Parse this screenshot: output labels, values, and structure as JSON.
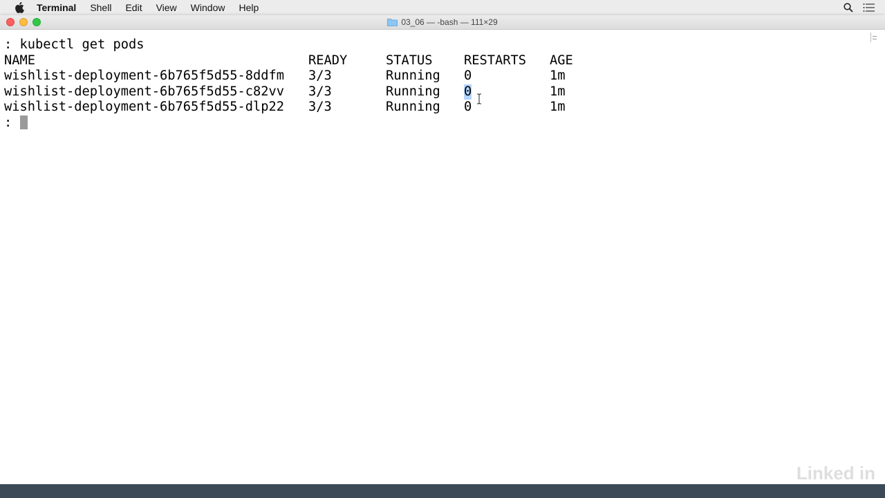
{
  "menubar": {
    "app_name": "Terminal",
    "items": [
      "Shell",
      "Edit",
      "View",
      "Window",
      "Help"
    ]
  },
  "window": {
    "title": "03_06 — -bash — 111×29"
  },
  "terminal": {
    "command_line": ": kubectl get pods",
    "headers": [
      "NAME",
      "READY",
      "STATUS",
      "RESTARTS",
      "AGE"
    ],
    "rows": [
      [
        "wishlist-deployment-6b765f5d55-8ddfm",
        "3/3",
        "Running",
        "0",
        "1m"
      ],
      [
        "wishlist-deployment-6b765f5d55-c82vv",
        "3/3",
        "Running",
        "0",
        "1m"
      ],
      [
        "wishlist-deployment-6b765f5d55-dlp22",
        "3/3",
        "Running",
        "0",
        "1m"
      ]
    ],
    "prompt": ": "
  },
  "watermark": "Linked in"
}
